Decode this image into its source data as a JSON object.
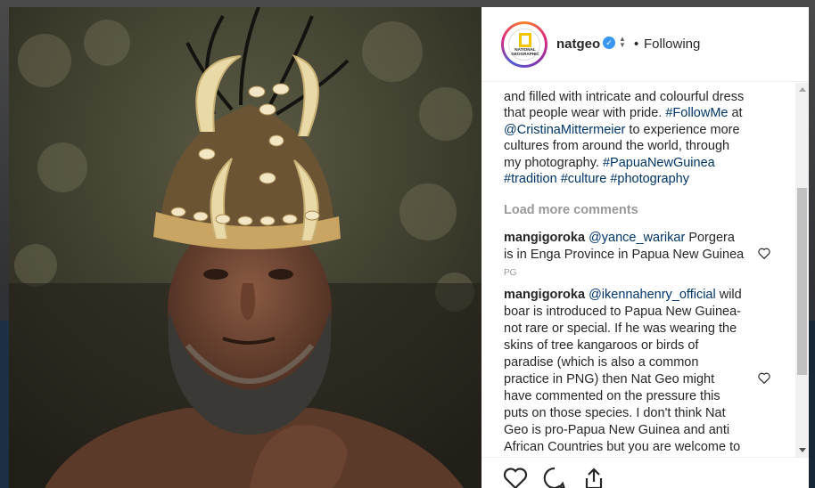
{
  "post": {
    "account": {
      "username": "natgeo",
      "separator": "•",
      "follow_status": "Following",
      "logo_text": "NATIONAL GEOGRAPHIC"
    },
    "caption": {
      "line1": "and filled with intricate and colourful dress",
      "line2a": "that people wear with pride. ",
      "tag_followme": "#FollowMe",
      "line2b": " at",
      "mention": "@CristinaMittermeier",
      "line3": " to experience more",
      "line4": "cultures from around the world, through",
      "line5a": "my photography. ",
      "tag_png": "#PapuaNewGuinea",
      "tag_tradition": "#tradition",
      "tag_culture": "#culture",
      "tag_photography": "#photography"
    },
    "load_more_label": "Load more comments",
    "comments": [
      {
        "user": "mangigoroka",
        "mention": "@yance_warikar",
        "text": " Porgera is in Enga Province in Papua New Guinea",
        "suffix": "PG"
      },
      {
        "user": "mangigoroka",
        "mention": "@ikennahenry_official",
        "text": " wild boar is introduced to Papua New Guinea- not rare or special. If he was wearing the skins of tree kangaroos or birds of paradise (which is also a common practice in PNG) then Nat Geo might have commented on the pressure this puts on those species. I don't think Nat Geo is pro-Papua New Guinea and anti African Countries but you are welcome to your opinion."
      }
    ],
    "actions": {
      "like_icon": "heart-outline-icon",
      "comment_icon": "speech-bubble-icon",
      "share_icon": "share-upload-icon"
    }
  },
  "colors": {
    "link": "#003569",
    "verified": "#3897f0",
    "text": "#262626",
    "muted": "#999999"
  }
}
